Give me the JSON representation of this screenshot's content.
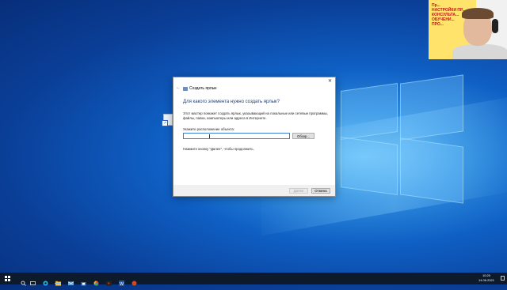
{
  "cam_overlay": {
    "banner_lines": [
      "Пр...",
      "НАСТРОЙКИ ПР...",
      "КОНСУЛЬТА...",
      "ОБУЧЕНИ...",
      "ПРО..."
    ]
  },
  "dialog": {
    "window_title": "Создать ярлык",
    "question": "Для какого элемента нужно создать ярлык?",
    "intro": "Этот мастер поможет создать ярлык, указывающий на локальные или сетевые программы, файлы, папки, компьютеры или адреса в Интернете.",
    "location_label": "Укажите расположение объекта:",
    "location_value": "",
    "browse_label": "Обзор...",
    "hint": "Нажмите кнопку \"Далее\", чтобы продолжить.",
    "next_label": "Далее",
    "cancel_label": "Отмена"
  },
  "taskbar": {
    "time": "10:20",
    "date": "14.06.2021"
  },
  "colors": {
    "accent": "#0078d7",
    "taskbar": "#0c1a2b"
  }
}
